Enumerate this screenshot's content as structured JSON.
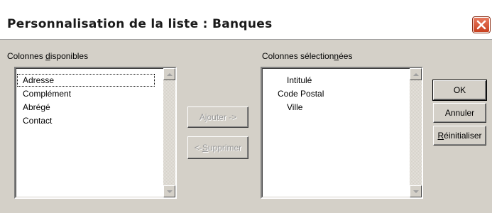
{
  "dialog": {
    "title": "Personnalisation de la liste : Banques"
  },
  "available": {
    "label_pre": "Colonnes ",
    "label_mn": "d",
    "label_post": "isponibles",
    "items": [
      "Adresse",
      "Complément",
      "Abrégé",
      "Contact"
    ]
  },
  "selected": {
    "label_pre": "Colonnes sélection",
    "label_mn": "n",
    "label_post": "ées",
    "items": [
      "Intitulé",
      "Code Postal",
      "Ville"
    ]
  },
  "buttons": {
    "add": "Ajouter ->",
    "remove_pre": "<- ",
    "remove_mn": "S",
    "remove_post": "upprimer",
    "ok": "OK",
    "cancel": "Annuler",
    "reset_mn": "R",
    "reset_post": "éinitialiser"
  },
  "icons": {
    "close": "close-icon",
    "scroll_up": "scroll-up-arrow-icon",
    "scroll_down": "scroll-down-arrow-icon"
  },
  "colors": {
    "dialog_bg": "#d4d0c8",
    "close_button": "#c9401f"
  }
}
